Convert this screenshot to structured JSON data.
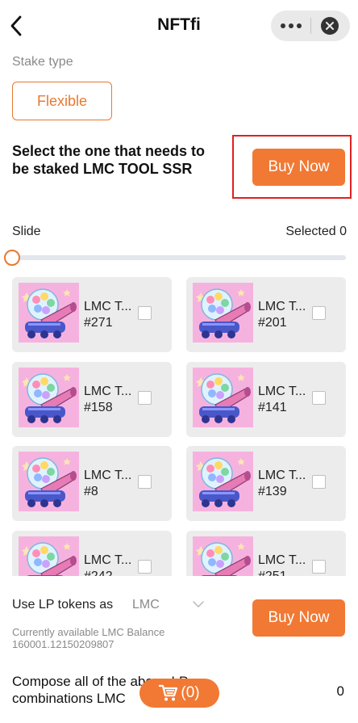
{
  "nav": {
    "title": "NFTfi",
    "back_icon": "chevron-left-icon",
    "more_icon": "more-dots-icon",
    "close_icon": "close-circle-icon"
  },
  "stake": {
    "label": "Stake type",
    "option": "Flexible"
  },
  "instruction": {
    "text": "Select the one that needs to be staked LMC TOOL SSR",
    "buy_label": "Buy Now"
  },
  "slide": {
    "label": "Slide",
    "selected_label": "Selected",
    "selected_count": "0",
    "value": 0
  },
  "nft_items": [
    {
      "name": "LMC T...",
      "id": "#271"
    },
    {
      "name": "LMC T...",
      "id": "#201"
    },
    {
      "name": "LMC T...",
      "id": "#158"
    },
    {
      "name": "LMC T...",
      "id": "#141"
    },
    {
      "name": "LMC T...",
      "id": "#8"
    },
    {
      "name": "LMC T...",
      "id": "#139"
    },
    {
      "name": "LMC T...",
      "id": "#242"
    },
    {
      "name": "LMC T...",
      "id": "#251"
    }
  ],
  "lp": {
    "label": "Use LP tokens as",
    "token": "LMC",
    "balance_label": "Currently available LMC Balance",
    "balance_value": "160001.12150209807",
    "buy_label": "Buy Now"
  },
  "compose": {
    "text": "Compose all of the above LP combinations LMC",
    "value": "0"
  },
  "cart": {
    "label": "(0)",
    "icon": "cart-icon"
  },
  "colors": {
    "accent": "#f17934",
    "highlight": "#e02020",
    "card_bg": "#ececec",
    "nft_bg": "#f6b2df"
  }
}
